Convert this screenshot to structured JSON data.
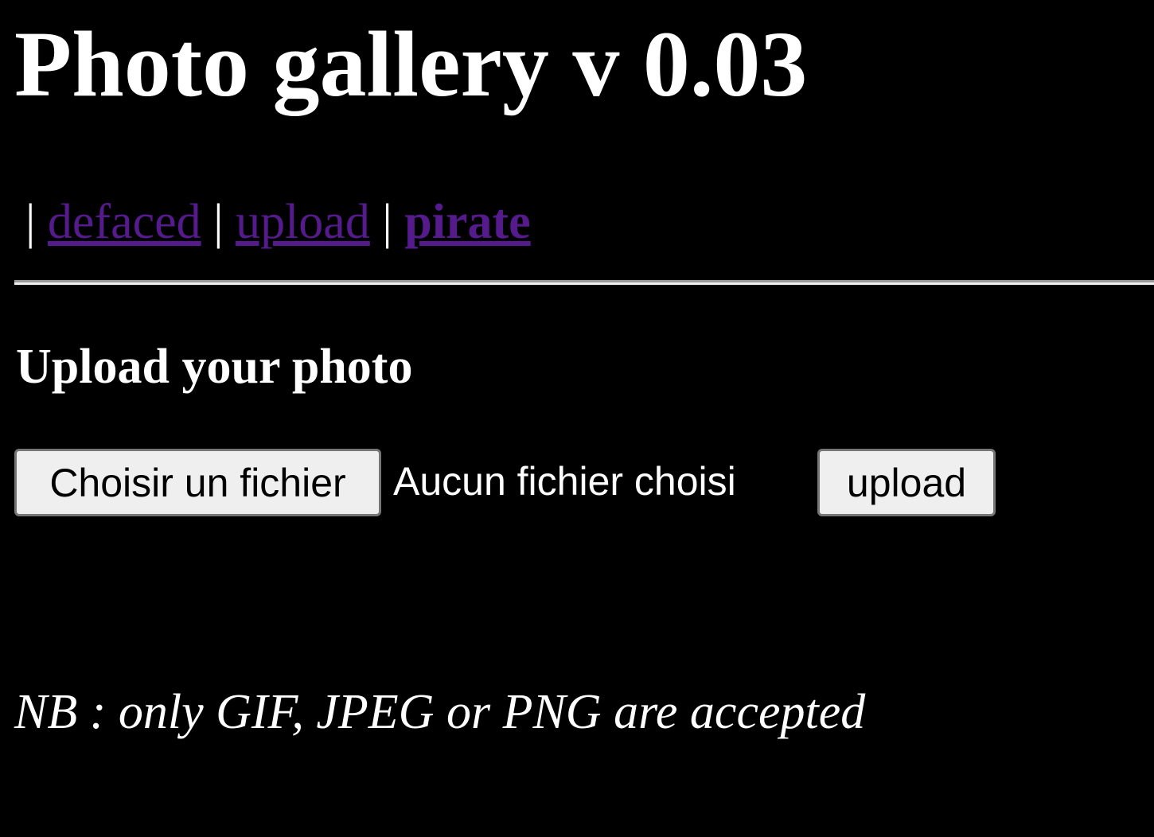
{
  "header": {
    "title": "Photo gallery v 0.03"
  },
  "nav": {
    "separator": "|",
    "links": [
      {
        "label": "defaced"
      },
      {
        "label": "upload"
      },
      {
        "label": "pirate"
      }
    ]
  },
  "upload_form": {
    "heading": "Upload your photo",
    "choose_file_label": "Choisir un fichier",
    "no_file_text": "Aucun fichier choisi",
    "submit_label": "upload"
  },
  "note": "NB : only GIF, JPEG or PNG are accepted",
  "colors": {
    "background": "#000000",
    "text": "#ffffff",
    "link": "#551a8b",
    "button_bg": "#efefef"
  }
}
